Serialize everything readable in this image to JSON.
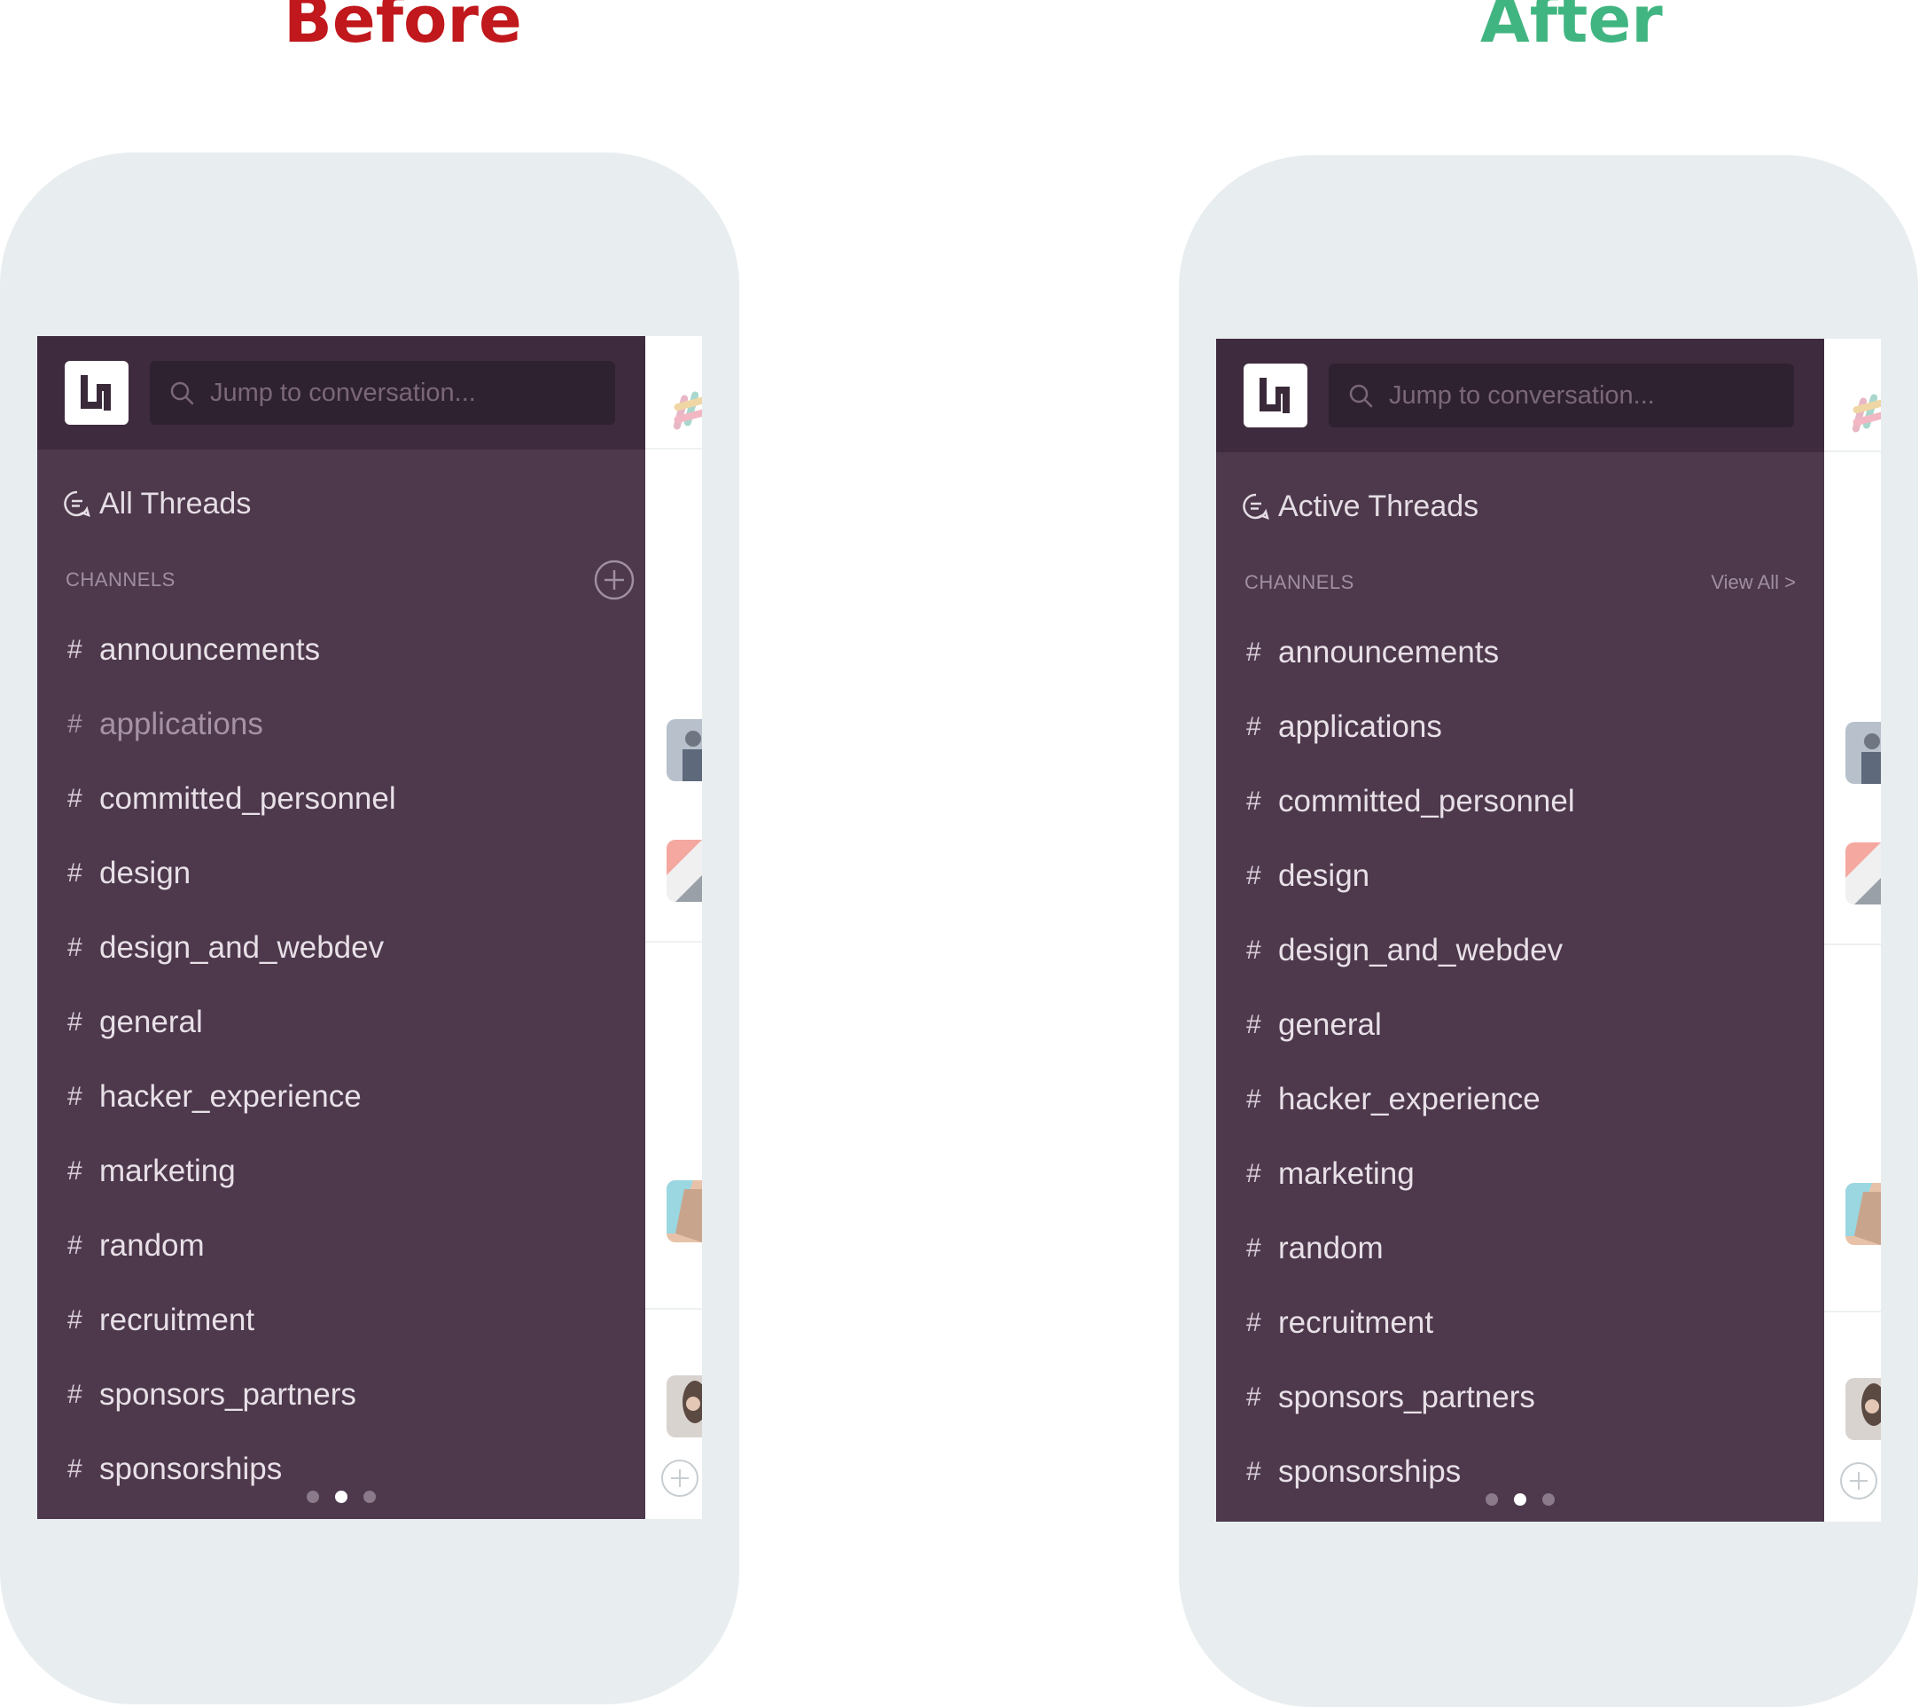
{
  "labels": {
    "before": "Before",
    "after": "After"
  },
  "colors": {
    "before": "#c0181c",
    "after": "#41b581",
    "sidebar": "#4d384c",
    "topbar": "#3f2b3e"
  },
  "before": {
    "search_placeholder": "Jump to conversation...",
    "threads_label": "All Threads",
    "channels_header": "CHANNELS",
    "channels": [
      "announcements",
      "applications",
      "committed_personnel",
      "design",
      "design_and_webdev",
      "general",
      "hacker_experience",
      "marketing",
      "random",
      "recruitment",
      "sponsors_partners",
      "sponsorships"
    ],
    "muted_channel": "applications",
    "page_indicator": {
      "count": 3,
      "active": 2
    }
  },
  "after": {
    "search_placeholder": "Jump to conversation...",
    "threads_label": "Active Threads",
    "channels_header": "CHANNELS",
    "view_all": "View All >",
    "channels": [
      "announcements",
      "applications",
      "committed_personnel",
      "design",
      "design_and_webdev",
      "general",
      "hacker_experience",
      "marketing",
      "random",
      "recruitment",
      "sponsors_partners",
      "sponsorships"
    ],
    "page_indicator": {
      "count": 3,
      "active": 2
    }
  }
}
